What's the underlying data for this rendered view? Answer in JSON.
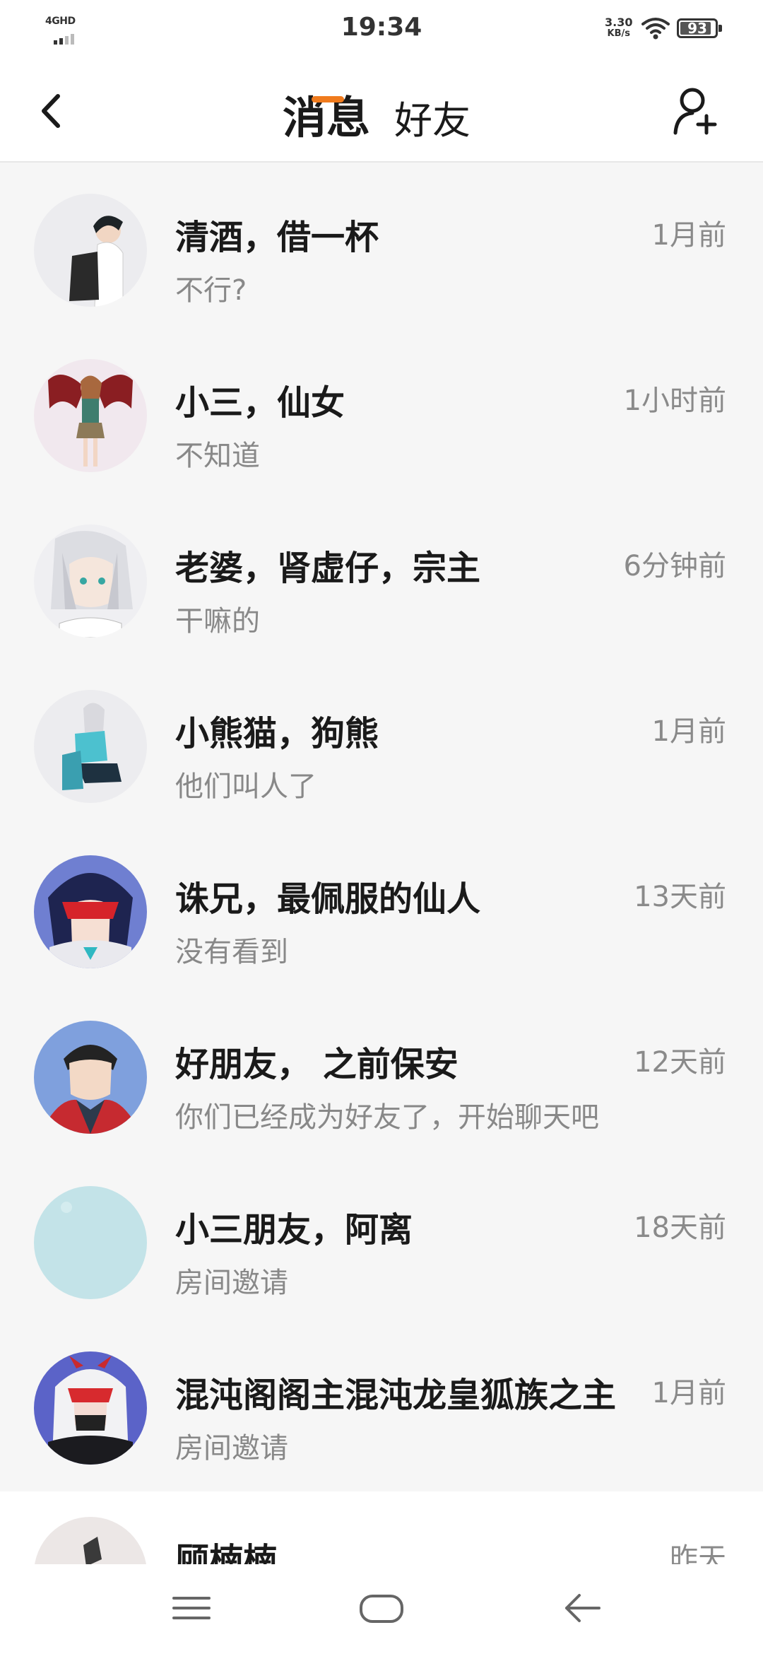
{
  "status_bar": {
    "network": "4GHD",
    "time": "19:34",
    "speed_value": "3.30",
    "speed_unit": "KB/s",
    "battery": "93",
    "battery_level": 0.93
  },
  "header": {
    "tab_active": "消息",
    "tab_inactive": "好友"
  },
  "colors": {
    "accent": "#f07b1d",
    "primary_text": "#1a1a1a",
    "secondary_text": "#888888",
    "background": "#f6f6f6"
  },
  "conversations": [
    {
      "name": "清酒，借一杯",
      "preview": "不行?",
      "time": "1月前",
      "avatar": "anime-boy-backpack-avatar"
    },
    {
      "name": "小三，仙女",
      "preview": "不知道",
      "time": "1小时前",
      "avatar": "anime-girl-wings-avatar"
    },
    {
      "name": "老婆，肾虚仔，宗主",
      "preview": "干嘛的",
      "time": "6分钟前",
      "avatar": "white-hair-anime-avatar"
    },
    {
      "name": "小熊猫，狗熊",
      "preview": "他们叫人了",
      "time": "1月前",
      "avatar": "anime-sitting-figure-avatar"
    },
    {
      "name": "诛兄，最佩服的仙人",
      "preview": "没有看到",
      "time": "13天前",
      "avatar": "red-mask-anime-avatar"
    },
    {
      "name": "好朋友， 之前保安",
      "preview": "你们已经成为好友了，开始聊天吧",
      "time": "12天前",
      "avatar": "dark-hair-anime-boy-avatar"
    },
    {
      "name": " 小三朋友，阿离",
      "preview": "房间邀请",
      "time": "18天前",
      "avatar": "light-blue-blank-avatar"
    },
    {
      "name": "混沌阁阁主混沌龙皇狐族之主",
      "preview": "房间邀请",
      "time": "1月前",
      "avatar": "white-hair-mask-anime-avatar"
    },
    {
      "name": "顾楠楠",
      "preview": "",
      "time": "昨天",
      "avatar": "anime-girl-pink-avatar"
    }
  ]
}
